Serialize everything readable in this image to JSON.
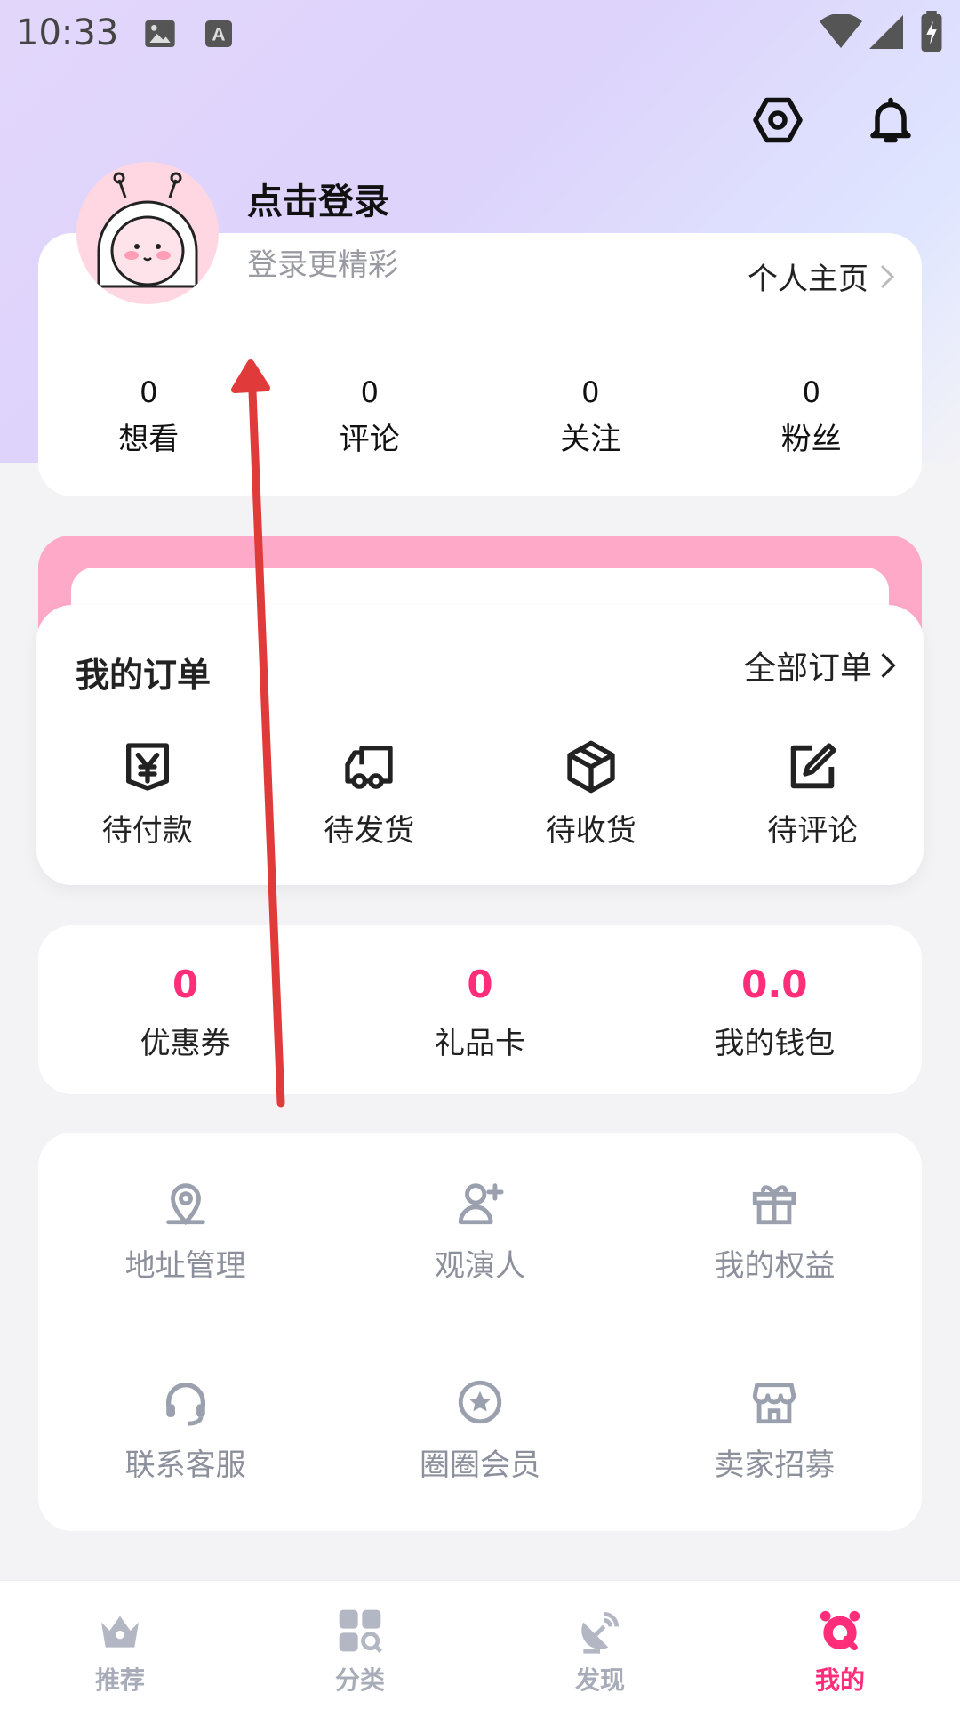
{
  "status_bar": {
    "time": "10:33"
  },
  "profile": {
    "login_title": "点击登录",
    "login_subtitle": "登录更精彩",
    "homepage_link": "个人主页",
    "stats": [
      {
        "value": "0",
        "label": "想看"
      },
      {
        "value": "0",
        "label": "评论"
      },
      {
        "value": "0",
        "label": "关注"
      },
      {
        "value": "0",
        "label": "粉丝"
      }
    ]
  },
  "orders": {
    "title": "我的订单",
    "all_link": "全部订单",
    "items": [
      {
        "label": "待付款",
        "icon": "yen-box-icon"
      },
      {
        "label": "待发货",
        "icon": "delivery-truck-icon"
      },
      {
        "label": "待收货",
        "icon": "package-box-icon"
      },
      {
        "label": "待评论",
        "icon": "edit-square-icon"
      }
    ]
  },
  "assets": [
    {
      "value": "0",
      "label": "优惠券"
    },
    {
      "value": "0",
      "label": "礼品卡"
    },
    {
      "value": "0.0",
      "label": "我的钱包"
    }
  ],
  "services": [
    {
      "label": "地址管理",
      "icon": "location-pin-icon"
    },
    {
      "label": "观演人",
      "icon": "add-person-icon"
    },
    {
      "label": "我的权益",
      "icon": "gift-icon"
    },
    {
      "label": "联系客服",
      "icon": "headset-icon"
    },
    {
      "label": "圈圈会员",
      "icon": "star-circle-icon"
    },
    {
      "label": "卖家招募",
      "icon": "shop-icon"
    }
  ],
  "bottom_nav": [
    {
      "label": "推荐",
      "icon": "crown-icon",
      "active": false
    },
    {
      "label": "分类",
      "icon": "category-grid-icon",
      "active": false
    },
    {
      "label": "发现",
      "icon": "satellite-dish-icon",
      "active": false
    },
    {
      "label": "我的",
      "icon": "profile-face-icon",
      "active": true
    }
  ],
  "colors": {
    "accent": "#ff2d7a",
    "inactive": "#a8acb8",
    "pink_band": "#ffa9c8"
  }
}
